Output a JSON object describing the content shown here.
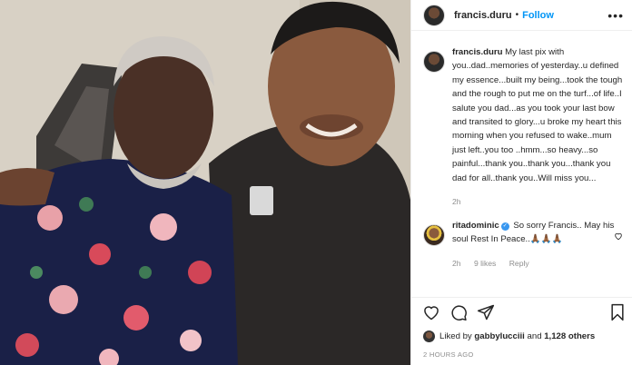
{
  "post": {
    "photo_alt": "",
    "header": {
      "username": "francis.duru",
      "separator": "•",
      "follow_label": "Follow",
      "more_label": "•••"
    },
    "caption": {
      "username": "francis.duru",
      "text": "My last pix with you..dad..memories of yesterday..u defined my essence...built my being...took the tough and the rough to put me on the turf...of life..I salute you dad...as you took your last bow and transited to glory...u broke my heart this morning when you refused to wake..mum just left..you too ..hmm...so heavy...so painful...thank you..thank you...thank you dad for all..thank you..Will miss you...",
      "age": "2h"
    },
    "comments": [
      {
        "username": "ritadominic",
        "verified": true,
        "text": "So sorry Francis.. May his soul Rest In Peace..🙏🏾🙏🏾🙏🏾",
        "age": "2h",
        "likes": "9 likes",
        "reply_label": "Reply"
      }
    ],
    "likes": {
      "prefix": "Liked by",
      "user": "gabbylucciii",
      "connector": "and",
      "others": "1,128 others"
    },
    "timestamp": "2 HOURS AGO"
  },
  "icons": {
    "like": "heart-icon",
    "comment": "comment-icon",
    "share": "paper-plane-icon",
    "save": "bookmark-icon",
    "comment_like": "heart-icon"
  },
  "colors": {
    "accent": "#0095f6",
    "text": "#262626",
    "muted": "#8e8e8e",
    "border": "#efefef"
  }
}
